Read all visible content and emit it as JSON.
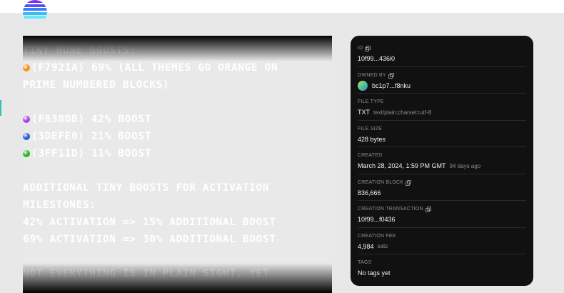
{
  "header": {
    "logo_colors": [
      "#7b2ff7",
      "#5b4ff5",
      "#3b82f6",
      "#38bdf8",
      "#67e8f9"
    ],
    "logo_icon": "striped-circle-logo-icon"
  },
  "preview": {
    "lines": [
      {
        "text": "TINY RUNE BOOSTS:"
      },
      {
        "text": "(F7921A) 69% (ALL THEMES GO ORANGE ON",
        "dot": "#f7921a"
      },
      {
        "text": "PRIME NUMBERED BLOCKS)"
      },
      {
        "text": ""
      },
      {
        "text": "(F838DB) 42% BOOST",
        "dot": "#b040e8"
      },
      {
        "text": "(3DEFE0) 21% BOOST",
        "dot": "#1e63d6"
      },
      {
        "text": "(3FF11D) 11% BOOST",
        "dot": "#28b81e"
      },
      {
        "text": ""
      },
      {
        "text": "ADDITIONAL TINY BOOSTS FOR ACTIVATION"
      },
      {
        "text": "MILESTONES:"
      },
      {
        "text": "42% ACTIVATION => 15% ADDITIONAL BOOST"
      },
      {
        "text": "69% ACTIVATION => 30% ADDITIONAL BOOST"
      },
      {
        "text": ""
      },
      {
        "text": "NOT EVERYTHING IS IN PLAIN SIGHT, YET"
      }
    ]
  },
  "details": {
    "id": {
      "label": "ID",
      "value": "10f99...436i0"
    },
    "owner": {
      "label": "OWNED BY",
      "value": "bc1p7...f8nku"
    },
    "file_type": {
      "label": "FILE TYPE",
      "value": "TXT",
      "mime": "text/plain;charset=utf-8"
    },
    "file_size": {
      "label": "FILE SIZE",
      "value": "428 bytes"
    },
    "created": {
      "label": "CREATED",
      "value": "March 28, 2024, 1:59 PM GMT",
      "relative": "94 days ago"
    },
    "creation_block": {
      "label": "CREATION BLOCK",
      "value": "836,666"
    },
    "creation_tx": {
      "label": "CREATION TRANSACTION",
      "value": "10f99...f0436"
    },
    "creation_fee": {
      "label": "CREATION FEE",
      "value": "4,984",
      "unit": "sats"
    },
    "tags": {
      "label": "TAGS",
      "value": "No tags yet"
    }
  }
}
